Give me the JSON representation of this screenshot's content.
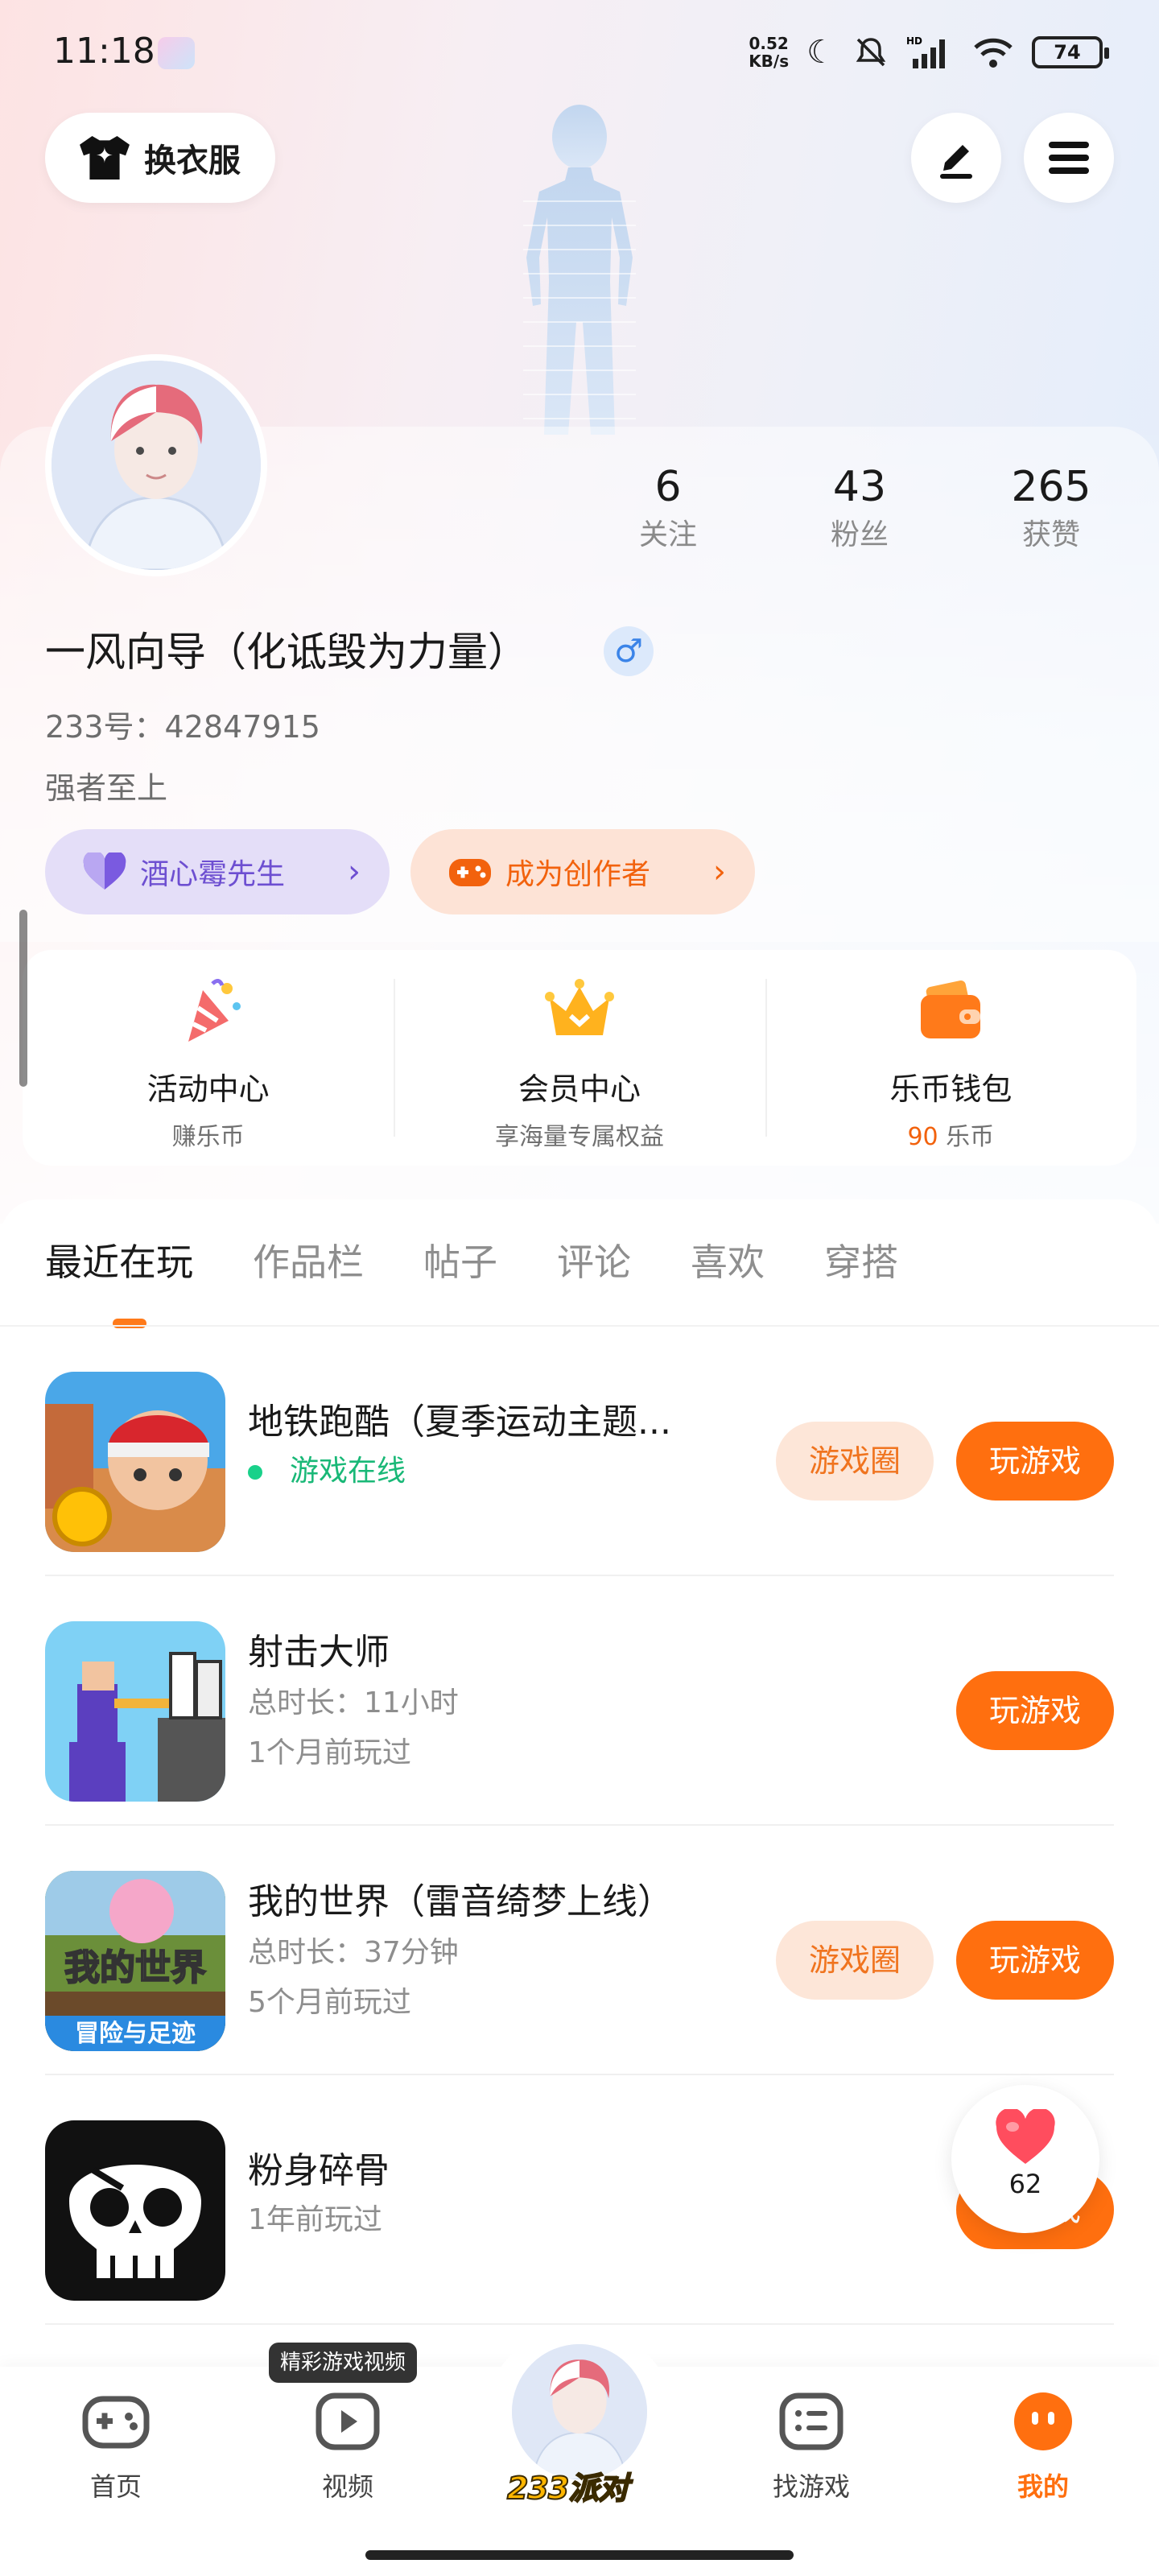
{
  "status_bar": {
    "time": "11:18",
    "net_speed_value": "0.52",
    "net_speed_unit": "KB/s",
    "signal_label": "HD",
    "battery": "74"
  },
  "header": {
    "outfit_label": "换衣服"
  },
  "profile": {
    "stats": [
      {
        "value": "6",
        "label": "关注"
      },
      {
        "value": "43",
        "label": "粉丝"
      },
      {
        "value": "265",
        "label": "获赞"
      }
    ],
    "name": "一风向导（化诋毁为力量）",
    "gender_symbol": "♂",
    "uid": "233号：42847915",
    "motto": "强者至上",
    "fan_badge": "酒心霉先生",
    "creator_badge": "成为创作者"
  },
  "quick_entries": [
    {
      "title": "活动中心",
      "sub": "赚乐币"
    },
    {
      "title": "会员中心",
      "sub": "享海量专属权益"
    },
    {
      "title": "乐币钱包",
      "coins": "90",
      "sub": " 乐币"
    }
  ],
  "tabs": [
    "最近在玩",
    "作品栏",
    "帖子",
    "评论",
    "喜欢",
    "穿搭"
  ],
  "games": [
    {
      "title": "地铁跑酷（夏季运动主题...",
      "status": "游戏在线",
      "circle_btn": "游戏圈",
      "play_btn": "玩游戏"
    },
    {
      "title": "射击大师",
      "duration": "总时长：11小时",
      "last_played": "1个月前玩过",
      "play_btn": "玩游戏"
    },
    {
      "title": "我的世界（雷音绮梦上线）",
      "duration": "总时长：37分钟",
      "last_played": "5个月前玩过",
      "circle_btn": "游戏圈",
      "play_btn": "玩游戏"
    },
    {
      "title": "粉身碎骨",
      "last_played": "1年前玩过",
      "play_btn": "玩游戏"
    }
  ],
  "like_count": "62",
  "bottom_nav": {
    "tooltip": "精彩游戏视频",
    "items": [
      "首页",
      "视频",
      "找游戏",
      "我的"
    ],
    "center_logo": "233派对"
  },
  "colors": {
    "accent": "#ff6f0f",
    "online": "#19b877",
    "fan_badge": "#6d4fd1"
  }
}
